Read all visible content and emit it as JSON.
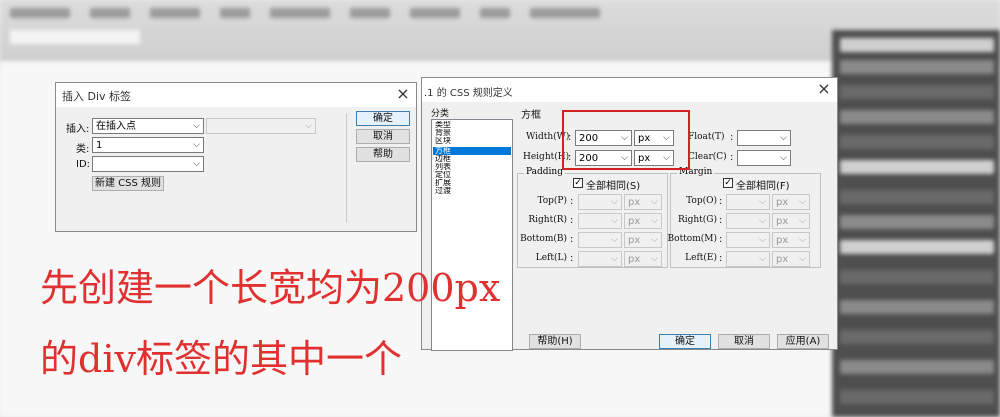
{
  "insert_div_dialog": {
    "title": "插入 Div 标签",
    "insert_label": "插入:",
    "insert_value": "在插入点",
    "class_label": "类:",
    "class_value": "1",
    "id_label": "ID:",
    "id_value": "",
    "new_css_rule_label": "新建 CSS 规则",
    "ok_label": "确定",
    "cancel_label": "取消",
    "help_label": "帮助"
  },
  "css_dialog": {
    "title": ".1 的 CSS 规则定义",
    "category_header": "分类",
    "categories": [
      "类型",
      "背景",
      "区块",
      "方框",
      "边框",
      "列表",
      "定位",
      "扩展",
      "过渡"
    ],
    "selected_category": "方框",
    "section_title": "方框",
    "width_label": "Width(W)",
    "width_value": "200",
    "width_unit": "px",
    "height_label": "Height(H)",
    "height_value": "200",
    "height_unit": "px",
    "float_label": "Float(T)",
    "clear_label": "Clear(C)",
    "padding": {
      "title": "Padding",
      "same_label": "全部相同(S)",
      "same_checked": true,
      "rows": [
        {
          "label": "Top(P)",
          "unit": "px"
        },
        {
          "label": "Right(R)",
          "unit": "px"
        },
        {
          "label": "Bottom(B)",
          "unit": "px"
        },
        {
          "label": "Left(L)",
          "unit": "px"
        }
      ]
    },
    "margin": {
      "title": "Margin",
      "same_label": "全部相同(F)",
      "same_checked": true,
      "rows": [
        {
          "label": "Top(O)",
          "unit": "px"
        },
        {
          "label": "Right(G)",
          "unit": "px"
        },
        {
          "label": "Bottom(M)",
          "unit": "px"
        },
        {
          "label": "Left(E)",
          "unit": "px"
        }
      ]
    },
    "help_label": "帮助(H)",
    "ok_label": "确定",
    "cancel_label": "取消",
    "apply_label": "应用(A)"
  },
  "caption": {
    "line1": "先创建一个长宽均为200px",
    "line2": "的div标签的其中一个"
  },
  "colors": {
    "highlight": "#d42020",
    "caption": "#e03030",
    "selection": "#0078d7"
  }
}
